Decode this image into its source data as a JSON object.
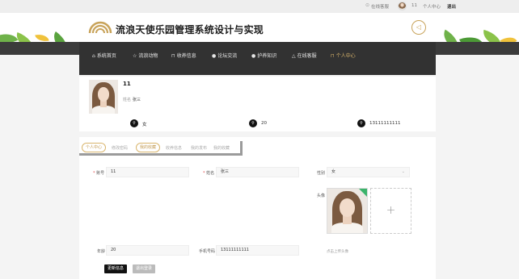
{
  "topbar": {
    "online_chat": "在线客服",
    "username": "11",
    "personal_center": "个人中心",
    "logout": "退出"
  },
  "site": {
    "title": "流浪天使乐园管理系统设计与实现"
  },
  "nav": {
    "items": [
      {
        "icon": "home-icon",
        "glyph": "⌂",
        "label": "系统首页"
      },
      {
        "icon": "star-icon",
        "glyph": "☆",
        "label": "流浪动物"
      },
      {
        "icon": "lock-icon",
        "glyph": "⊓",
        "label": "收养信息"
      },
      {
        "icon": "dot-icon",
        "glyph": "●",
        "label": "论坛交流"
      },
      {
        "icon": "dot-icon",
        "glyph": "●",
        "label": "护养知识"
      },
      {
        "icon": "warning-icon",
        "glyph": "△",
        "label": "在线客服"
      },
      {
        "icon": "lock-icon",
        "glyph": "⊓",
        "label": "个人中心"
      }
    ],
    "active_index": 6
  },
  "profile": {
    "name": "11",
    "name_label": "姓名",
    "name_value": "张三",
    "gender": "女",
    "age": "20",
    "phone": "13111111111"
  },
  "tabs": {
    "items": [
      "个人中心",
      "修改密码",
      "我的收藏",
      "收养信息",
      "我的发布",
      "我的收藏"
    ],
    "active": 2
  },
  "form": {
    "account_label": "账号",
    "account_value": "11",
    "name_label": "姓名",
    "name_value": "张三",
    "gender_label": "性别",
    "gender_value": "女",
    "avatar_label": "头像",
    "age_label": "年龄",
    "age_value": "20",
    "phone_label": "手机号码",
    "phone_value": "13111111111",
    "upload_hint": "点击上传头像",
    "upload_plus": "+",
    "update_button": "更新信息",
    "logout_button": "退出登录"
  },
  "colors": {
    "accent": "#d9b56c",
    "nav_bg": "#323232",
    "required": "#e04b4b"
  }
}
